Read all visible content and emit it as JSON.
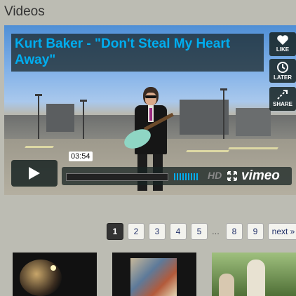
{
  "section": {
    "title": "Videos"
  },
  "video": {
    "title": "Kurt Baker - \"Don't Steal My Heart Away\"",
    "side_buttons": [
      {
        "label": "LIKE",
        "icon": "heart-icon"
      },
      {
        "label": "LATER",
        "icon": "clock-icon"
      },
      {
        "label": "SHARE",
        "icon": "share-icon"
      }
    ],
    "time": "03:54",
    "hd_label": "HD",
    "brand": "vimeo"
  },
  "pager": {
    "pages": [
      "1",
      "2",
      "3",
      "4",
      "5"
    ],
    "ellipsis": "...",
    "tail_pages": [
      "8",
      "9"
    ],
    "next_label": "next »",
    "active_page": "1"
  },
  "colors": {
    "accent": "#00adef",
    "background": "#bcbcb3",
    "overlay": "#172322"
  }
}
